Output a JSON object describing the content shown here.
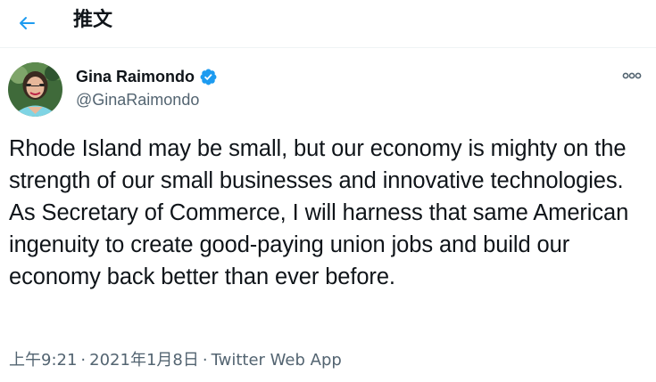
{
  "header": {
    "title": "推文",
    "back_icon": "arrow-left-icon",
    "accent": "#1d9bf0"
  },
  "tweet": {
    "author": {
      "name": "Gina Raimondo",
      "handle": "@GinaRaimondo",
      "verified": true,
      "verified_color": "#1d9bf0"
    },
    "more_icon": "more-horizontal-icon",
    "text": "Rhode Island may be small, but our economy is mighty on the strength of our small businesses and innovative technologies. As Secretary of Commerce, I will harness that same American ingenuity to create good-paying union jobs and build our economy back better than ever before.",
    "time": "上午9:21",
    "separator": "·",
    "date": "2021年1月8日",
    "source": "Twitter Web App"
  }
}
